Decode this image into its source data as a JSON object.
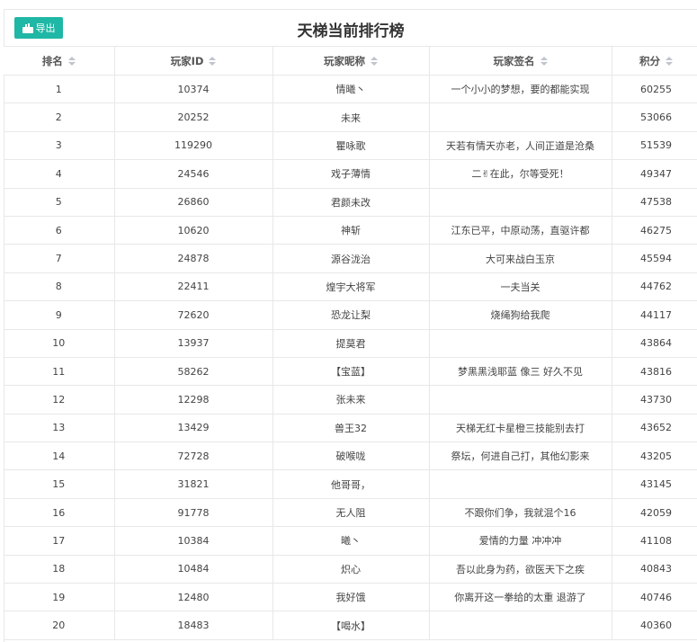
{
  "toolbar": {
    "export_label": "导出",
    "title": "天梯当前排行榜"
  },
  "table": {
    "columns": [
      "排名",
      "玩家ID",
      "玩家昵称",
      "玩家签名",
      "积分"
    ],
    "rows": [
      [
        "1",
        "10374",
        "情曦丶",
        "一个小小的梦想，要的都能实现",
        "60255"
      ],
      [
        "2",
        "20252",
        "未来",
        "",
        "53066"
      ],
      [
        "3",
        "119290",
        "瞿咏歌",
        "天若有情天亦老，人间正道是沧桑",
        "51539"
      ],
      [
        "4",
        "24546",
        "戏子薄情",
        "二✌在此，尔等受死！",
        "49347"
      ],
      [
        "5",
        "26860",
        "君颜未改",
        "",
        "47538"
      ],
      [
        "6",
        "10620",
        "神斩",
        "江东已平，中原动荡，直驱许都",
        "46275"
      ],
      [
        "7",
        "24878",
        "源谷泷治",
        "大可来战白玉京",
        "45594"
      ],
      [
        "8",
        "22411",
        "煌宇大将军",
        "一夫当关",
        "44762"
      ],
      [
        "9",
        "72620",
        "恐龙让梨",
        "烧绳狗给我爬",
        "44117"
      ],
      [
        "10",
        "13937",
        "提莫君",
        "",
        "43864"
      ],
      [
        "11",
        "58262",
        "【宝蓝】",
        "梦黑黑浅耶蓝 像三 好久不见",
        "43816"
      ],
      [
        "12",
        "12298",
        "张未来",
        "",
        "43730"
      ],
      [
        "13",
        "13429",
        "兽王32",
        "天梯无红卡星橙三技能别去打",
        "43652"
      ],
      [
        "14",
        "72728",
        "破喉咙",
        "祭坛，何进自己打，其他幻影来",
        "43205"
      ],
      [
        "15",
        "31821",
        "他哥哥，",
        "",
        "43145"
      ],
      [
        "16",
        "91778",
        "无人阻",
        "不跟你们争，我就混个16",
        "42059"
      ],
      [
        "17",
        "10384",
        "曦丶",
        "爱情的力量 冲冲冲",
        "41108"
      ],
      [
        "18",
        "10484",
        "炽心",
        "吾以此身为药，欲医天下之疾",
        "40843"
      ],
      [
        "19",
        "12480",
        "我好饿",
        "你离开这一拳给的太重 退游了",
        "40746"
      ],
      [
        "20",
        "18483",
        "【喝水】",
        "",
        "40360"
      ]
    ]
  }
}
